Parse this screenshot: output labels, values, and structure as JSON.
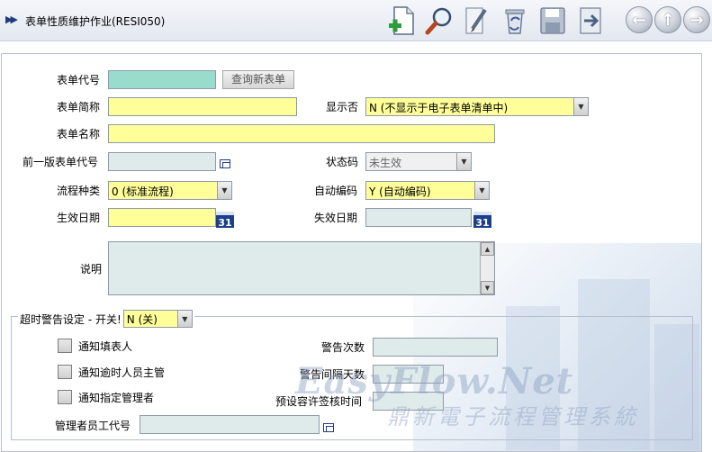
{
  "title": "表单性质维护作业(RESI050)",
  "toolbar": {
    "icons": [
      "add-document-icon",
      "search-icon",
      "edit-icon",
      "recycle-icon",
      "save-icon",
      "exit-icon"
    ],
    "nav": {
      "back": "←",
      "up": "↑",
      "forward": "→"
    }
  },
  "form": {
    "form_code": {
      "label": "表单代号",
      "value": ""
    },
    "query_button": "查询新表单",
    "short_name": {
      "label": "表单简称",
      "value": ""
    },
    "display": {
      "label": "显示否",
      "value": "N (不显示于电子表单清单中)"
    },
    "form_name": {
      "label": "表单名称",
      "value": ""
    },
    "prev_version": {
      "label": "前一版表单代号",
      "value": ""
    },
    "status": {
      "label": "状态码",
      "value": "未生效"
    },
    "flow_type": {
      "label": "流程种类",
      "value": "0 (标准流程)"
    },
    "auto_number": {
      "label": "自动编码",
      "value": "Y (自动编码)"
    },
    "effective_date": {
      "label": "生效日期",
      "value": ""
    },
    "expiry_date": {
      "label": "失效日期",
      "value": ""
    },
    "calendar_label": "31",
    "description": {
      "label": "说明",
      "value": ""
    }
  },
  "timeout": {
    "legend": "超时警告设定 - 开关!",
    "switch_value": "N (关)",
    "notify_filler": "通知填表人",
    "notify_overdue_supervisor": "通知逾时人员主管",
    "notify_admin": "通知指定管理者",
    "warn_count": {
      "label": "警告次数",
      "value": ""
    },
    "warn_interval": {
      "label": "警告间隔天数",
      "value": ""
    },
    "allowed_time": {
      "label": "预设容许签核时间",
      "value": ""
    },
    "admin_id": {
      "label": "管理者员工代号",
      "value": ""
    }
  },
  "watermark": {
    "logo": "EasyFlow.Net",
    "subtitle": "鼎新電子流程管理系統"
  }
}
